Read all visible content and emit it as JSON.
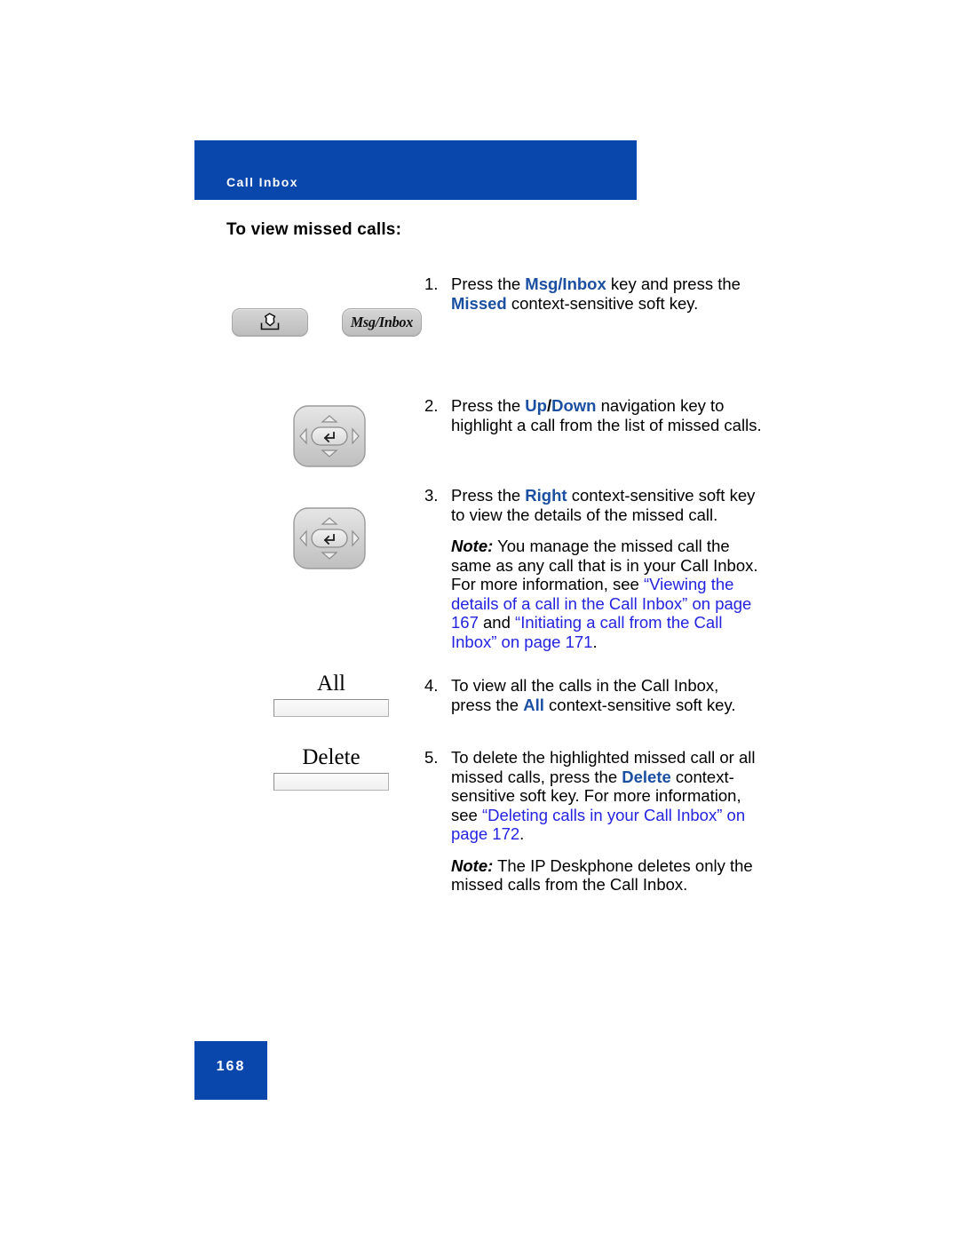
{
  "header": {
    "section_label": "Call Inbox",
    "banner_color": "#0a47ad"
  },
  "heading": "To view missed calls:",
  "graphics": {
    "inbox_key": {
      "icon": "inbox-tray-arrow-icon"
    },
    "msg_key": {
      "label": "Msg/Inbox"
    },
    "nav_key_1": {
      "icon": "navigation-rocker-icon"
    },
    "nav_key_2": {
      "icon": "navigation-rocker-icon"
    },
    "all_softkey": {
      "label": "All"
    },
    "delete_softkey": {
      "label": "Delete"
    }
  },
  "steps": [
    {
      "number": "1.",
      "parts": [
        {
          "text": "Press the "
        },
        {
          "text": "Msg/Inbox",
          "style": "term"
        },
        {
          "text": " key and press the "
        },
        {
          "text": "Missed",
          "style": "term"
        },
        {
          "text": " context-sensitive soft key."
        }
      ]
    },
    {
      "number": "2.",
      "parts": [
        {
          "text": "Press the "
        },
        {
          "text": "Up",
          "style": "term"
        },
        {
          "text": "/",
          "style": "sep"
        },
        {
          "text": "Down",
          "style": "term"
        },
        {
          "text": " navigation key to highlight a call from the list of missed calls."
        }
      ]
    },
    {
      "number": "3.",
      "parts": [
        {
          "text": "Press the "
        },
        {
          "text": "Right",
          "style": "term"
        },
        {
          "text": " context-sensitive soft key to view the details of the missed call."
        }
      ],
      "note": {
        "label": "Note:",
        "parts": [
          {
            "text": " You manage the missed call the same as any call that is in your Call Inbox. For more information, see "
          },
          {
            "text": "“Viewing the details of a call in the Call Inbox” on page 167",
            "style": "xref"
          },
          {
            "text": " and "
          },
          {
            "text": "“Initiating a call from the Call Inbox” on page 171",
            "style": "xref"
          },
          {
            "text": "."
          }
        ]
      }
    },
    {
      "number": "4.",
      "parts": [
        {
          "text": "To view all the calls in the Call Inbox, press the "
        },
        {
          "text": "All",
          "style": "term"
        },
        {
          "text": " context-sensitive soft key."
        }
      ]
    },
    {
      "number": "5.",
      "parts": [
        {
          "text": "To delete the highlighted missed call or all missed calls, press the "
        },
        {
          "text": "Delete",
          "style": "term"
        },
        {
          "text": " context-sensitive soft key. For more information, see "
        },
        {
          "text": "“Deleting calls in your Call Inbox” on page 172",
          "style": "xref"
        },
        {
          "text": "."
        }
      ],
      "note": {
        "label": "Note:",
        "parts": [
          {
            "text": " The IP Deskphone deletes only the missed calls from the Call Inbox."
          }
        ]
      }
    }
  ],
  "footer": {
    "page_number": "168",
    "box_color": "#0a47ad"
  },
  "colors": {
    "brand_blue": "#0a47ad",
    "term_blue": "#1a4fa2",
    "link_blue": "#2323e0"
  }
}
